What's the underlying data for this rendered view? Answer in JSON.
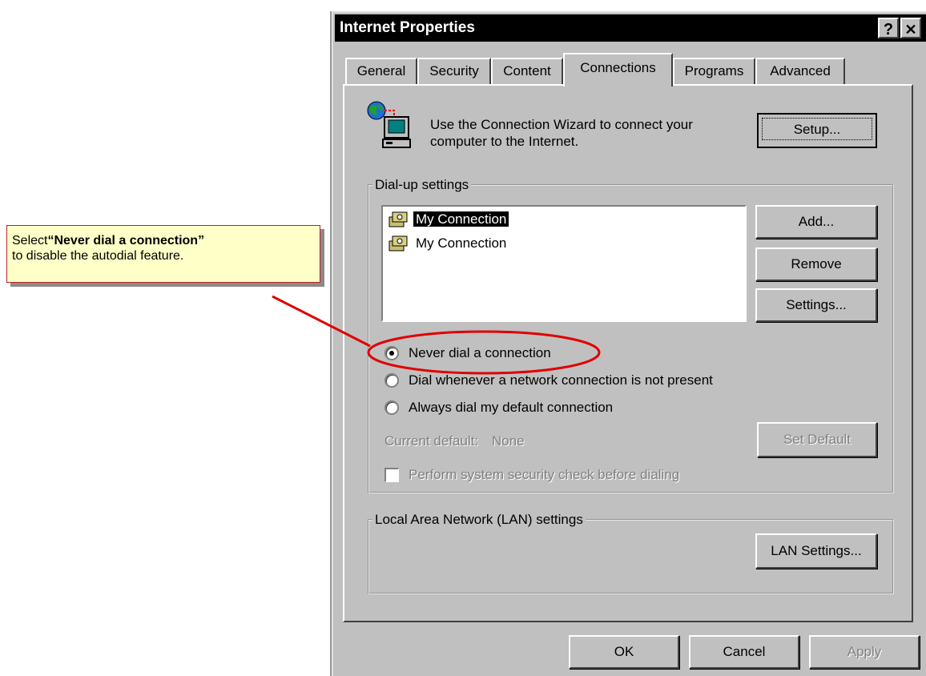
{
  "callout": {
    "prefix": "Select ",
    "bold_text": "“Never dial a connection”",
    "suffix": " to disable the autodial feature."
  },
  "window": {
    "title": "Internet Properties",
    "help_label": "?",
    "close_label": "✕"
  },
  "tabs": [
    {
      "label": "General",
      "active": false
    },
    {
      "label": "Security",
      "active": false
    },
    {
      "label": "Content",
      "active": false
    },
    {
      "label": "Connections",
      "active": true
    },
    {
      "label": "Programs",
      "active": false
    },
    {
      "label": "Advanced",
      "active": false
    }
  ],
  "wizard": {
    "text_line1": "Use the Connection Wizard to connect your",
    "text_line2": "computer to the Internet.",
    "setup_label": "Setup..."
  },
  "dialup": {
    "group_label": "Dial-up settings",
    "connections": [
      {
        "name": "My Connection",
        "selected": true
      },
      {
        "name": "My Connection",
        "selected": false
      }
    ],
    "add_label": "Add...",
    "remove_label": "Remove",
    "settings_label": "Settings...",
    "options": [
      {
        "label": "Never dial a connection",
        "checked": true
      },
      {
        "label": "Dial whenever a network connection is not present",
        "checked": false
      },
      {
        "label": "Always dial my default connection",
        "checked": false
      }
    ],
    "current_default_label": "Current default:",
    "current_default_value": "None",
    "set_default_label": "Set Default",
    "security_check_label": "Perform system security check before dialing",
    "security_check_checked": false
  },
  "lan": {
    "group_label": "Local Area Network (LAN) settings",
    "lan_settings_label": "LAN Settings..."
  },
  "footer": {
    "ok_label": "OK",
    "cancel_label": "Cancel",
    "apply_label": "Apply"
  },
  "colors": {
    "dialog_face": "#c0c0c0",
    "title_bar": "#000000",
    "callout_fill": "#ffffc8",
    "annotation_red": "#e00000"
  }
}
